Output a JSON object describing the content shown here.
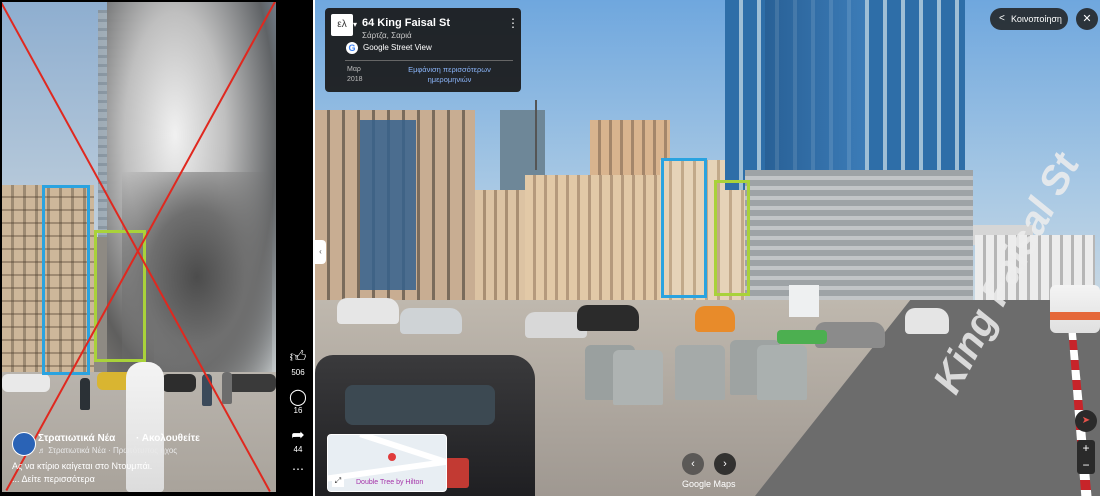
{
  "left_panel": {
    "creator": {
      "name": "Στρατιωτικά Νέα",
      "follow_label": "· Ακολουθείτε",
      "audio": "♬ Στρατιωτικά Νέα · Πρωτότυπος ήχος"
    },
    "caption": "Ας να κτίριο καίγεται στο Ντουμπάι.",
    "more_label": "... Δείτε περισσότερα",
    "actions": {
      "likes_icon": "thumbs-up-icon",
      "likes": "506",
      "comments_icon": "comment-icon",
      "comments": "16",
      "shares_icon": "share-icon",
      "shares": "44",
      "more_icon": "more-dots-icon"
    },
    "annotation_colors": {
      "cross": "#e0281f",
      "blue_box": "#2aa3e0",
      "green_box": "#a9d23a"
    }
  },
  "street_view": {
    "back_label": "ελ",
    "title": "64 King Faisal St",
    "subtitle": "Σάρτζα, Σαριά",
    "provider": "Google Street View",
    "capture_month": "Μαρ",
    "capture_year": "2018",
    "more_dates": "Εμφάνιση περισσότερων ημερομηνιών",
    "share_label": "Κοινοποίηση",
    "close_label": "✕",
    "road_label": "King Faisal St",
    "minimap_label": "Double Tree by Hilton",
    "footer": "Google Maps",
    "zoom_in": "+",
    "zoom_out": "−",
    "nav_prev": "‹",
    "nav_next": "›"
  }
}
